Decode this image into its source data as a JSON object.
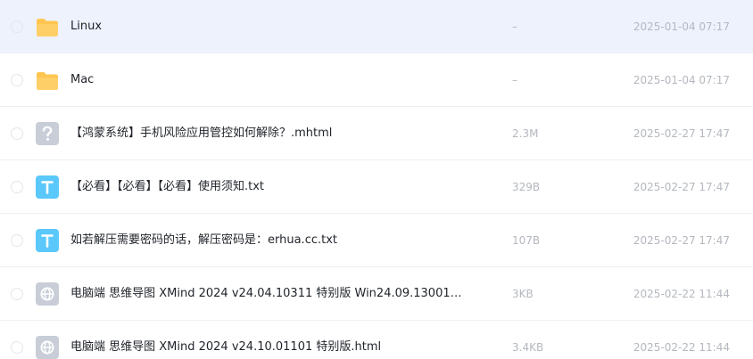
{
  "files": [
    {
      "name": "Linux",
      "size": "–",
      "modified": "2025-01-04 07:17",
      "type": "folder",
      "icon": "folder-icon"
    },
    {
      "name": "Mac",
      "size": "–",
      "modified": "2025-01-04 07:17",
      "type": "folder",
      "icon": "folder-icon"
    },
    {
      "name": "【鸿蒙系统】手机风险应用管控如何解除？.mhtml",
      "size": "2.3M",
      "modified": "2025-02-27 17:47",
      "type": "unknown",
      "icon": "unknown-file-icon"
    },
    {
      "name": "【必看】【必看】【必看】使用须知.txt",
      "size": "329B",
      "modified": "2025-02-27 17:47",
      "type": "text",
      "icon": "text-file-icon"
    },
    {
      "name": "如若解压需要密码的话，解压密码是：erhua.cc.txt",
      "size": "107B",
      "modified": "2025-02-27 17:47",
      "type": "text",
      "icon": "text-file-icon"
    },
    {
      "name": "电脑端 思维导图 XMind 2024 v24.04.10311 特别版 Win24.09.13001_...",
      "size": "3KB",
      "modified": "2025-02-22 11:44",
      "type": "web",
      "icon": "web-file-icon"
    },
    {
      "name": "电脑端 思维导图 XMind 2024 v24.10.01101 特别版.html",
      "size": "3.4KB",
      "modified": "2025-02-22 11:44",
      "type": "web",
      "icon": "web-file-icon"
    }
  ],
  "colors": {
    "hover_row": "#eef2fd",
    "folder": "#ffc550",
    "text_icon": "#5ac8fa",
    "generic_icon": "#c8cdd8",
    "meta_text": "#b4b8bf"
  }
}
